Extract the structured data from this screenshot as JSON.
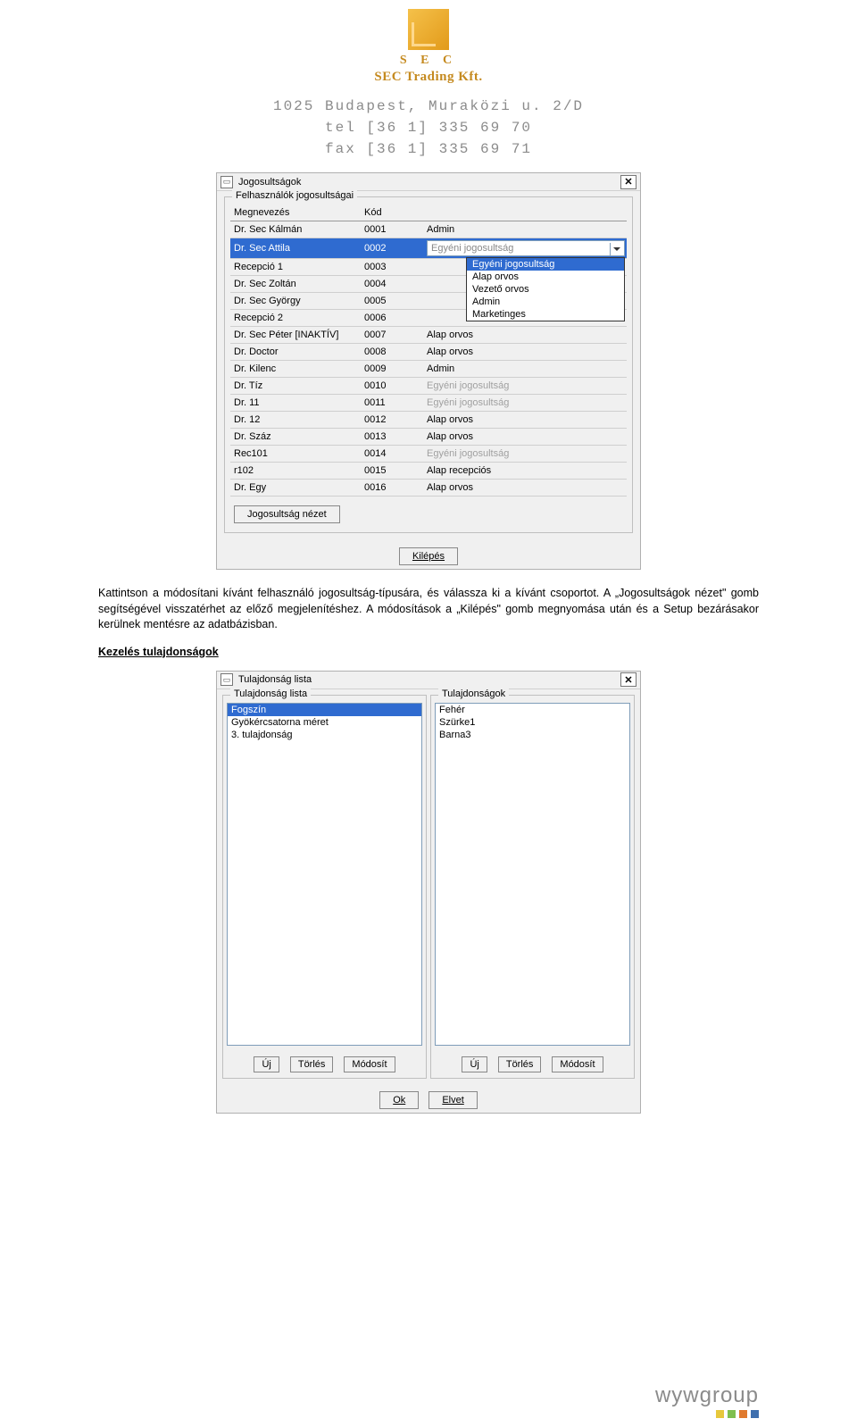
{
  "header": {
    "brand_short": "S E C",
    "brand_long": "SEC Trading Kft.",
    "address": "1025 Budapest, Muraközi u. 2/D",
    "tel": "tel [36 1] 335 69 70",
    "fax": "fax [36 1] 335 69 71"
  },
  "win1": {
    "title": "Jogosultságok",
    "close_glyph": "✕",
    "legend": "Felhasználók jogosultságai",
    "columns": {
      "name": "Megnevezés",
      "code": "Kód",
      "role": ""
    },
    "rows": [
      {
        "name": "Dr. Sec Kálmán",
        "code": "0001",
        "role": "Admin",
        "faded": false
      },
      {
        "name": "Dr. Sec Attila",
        "code": "0002",
        "role": "Egyéni jogosultság",
        "faded": false,
        "selected": true,
        "dropdown": true
      },
      {
        "name": "Recepció 1",
        "code": "0003",
        "role": "",
        "faded": false
      },
      {
        "name": "Dr. Sec Zoltán",
        "code": "0004",
        "role": "",
        "faded": false
      },
      {
        "name": "Dr. Sec György",
        "code": "0005",
        "role": "",
        "faded": false
      },
      {
        "name": "Recepció 2",
        "code": "0006",
        "role": "",
        "faded": false
      },
      {
        "name": "Dr. Sec Péter [INAKTÍV]",
        "code": "0007",
        "role": "Alap orvos",
        "faded": false
      },
      {
        "name": "Dr. Doctor",
        "code": "0008",
        "role": "Alap orvos",
        "faded": false
      },
      {
        "name": "Dr. Kilenc",
        "code": "0009",
        "role": "Admin",
        "faded": false
      },
      {
        "name": "Dr. Tíz",
        "code": "0010",
        "role": "Egyéni jogosultság",
        "faded": true
      },
      {
        "name": "Dr. 11",
        "code": "0011",
        "role": "Egyéni jogosultság",
        "faded": true
      },
      {
        "name": "Dr. 12",
        "code": "0012",
        "role": "Alap orvos",
        "faded": false
      },
      {
        "name": "Dr. Száz",
        "code": "0013",
        "role": "Alap orvos",
        "faded": false
      },
      {
        "name": "Rec101",
        "code": "0014",
        "role": "Egyéni jogosultság",
        "faded": true
      },
      {
        "name": "r102",
        "code": "0015",
        "role": "Alap recepciós",
        "faded": false
      },
      {
        "name": "Dr. Egy",
        "code": "0016",
        "role": "Alap orvos",
        "faded": false
      }
    ],
    "dropdown_options": [
      {
        "label": "Egyéni jogosultság",
        "selected": true
      },
      {
        "label": "Alap orvos",
        "selected": false
      },
      {
        "label": "Vezető orvos",
        "selected": false
      },
      {
        "label": "Admin",
        "selected": false
      },
      {
        "label": "Marketinges",
        "selected": false
      }
    ],
    "view_button": "Jogosultság nézet",
    "exit_button": "Kilépés"
  },
  "paragraph1": "Kattintson a módosítani kívánt felhasználó jogosultság-típusára, és válassza ki a kívánt csoportot. A „Jogosultságok nézet\" gomb segítségével visszatérhet az előző megjelenítéshez. A módosítások a „Kilépés\" gomb megnyomása után és a Setup bezárásakor kerülnek mentésre az adatbázisban.",
  "section_title": "Kezelés tulajdonságok",
  "win2": {
    "title": "Tulajdonság lista",
    "close_glyph": "✕",
    "pane1": {
      "legend": "Tulajdonság lista",
      "items": [
        {
          "label": "Fogszín",
          "selected": true
        },
        {
          "label": "Gyökércsatorna méret",
          "selected": false
        },
        {
          "label": "3. tulajdonság",
          "selected": false
        }
      ]
    },
    "pane2": {
      "legend": "Tulajdonságok",
      "items": [
        {
          "label": "Fehér",
          "selected": false
        },
        {
          "label": "Szürke1",
          "selected": false
        },
        {
          "label": "Barna3",
          "selected": false
        }
      ]
    },
    "btn_new": "Új",
    "btn_delete": "Törlés",
    "btn_modify": "Módosít",
    "btn_ok": "Ok",
    "btn_cancel": "Elvet"
  },
  "footer": {
    "brand": "wywgroup",
    "dot_colors": [
      "#e7c83c",
      "#7fbf4f",
      "#e07a2e",
      "#3f6fae"
    ]
  }
}
